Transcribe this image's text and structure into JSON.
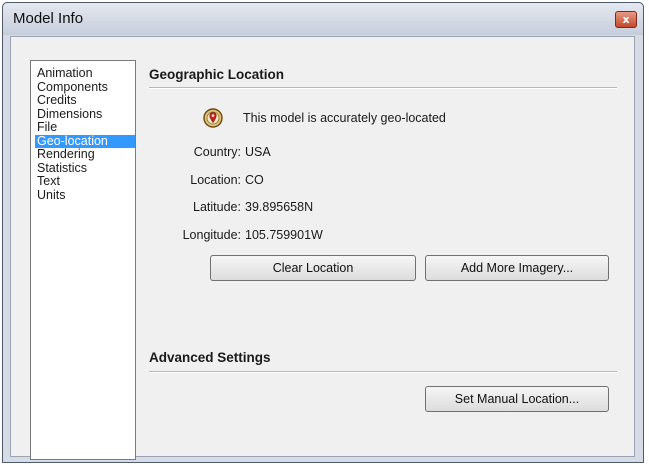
{
  "window": {
    "title": "Model Info",
    "close_glyph": "x"
  },
  "sidebar": {
    "items": [
      {
        "label": "Animation"
      },
      {
        "label": "Components"
      },
      {
        "label": "Credits"
      },
      {
        "label": "Dimensions"
      },
      {
        "label": "File"
      },
      {
        "label": "Geo-location"
      },
      {
        "label": "Rendering"
      },
      {
        "label": "Statistics"
      },
      {
        "label": "Text"
      },
      {
        "label": "Units"
      }
    ],
    "selected": "Geo-location"
  },
  "geo": {
    "section_title": "Geographic Location",
    "status_text": "This model is accurately geo-located",
    "status_icon": "geo-located-icon",
    "country_label": "Country:",
    "country_value": "USA",
    "location_label": "Location:",
    "location_value": "CO",
    "latitude_label": "Latitude:",
    "latitude_value": "39.895658N",
    "longitude_label": "Longitude:",
    "longitude_value": "105.759901W",
    "clear_button": "Clear Location",
    "imagery_button": "Add More Imagery..."
  },
  "advanced": {
    "section_title": "Advanced Settings",
    "manual_button": "Set Manual Location..."
  },
  "colors": {
    "selection": "#3399ff",
    "close_button": "#c24a2c"
  }
}
